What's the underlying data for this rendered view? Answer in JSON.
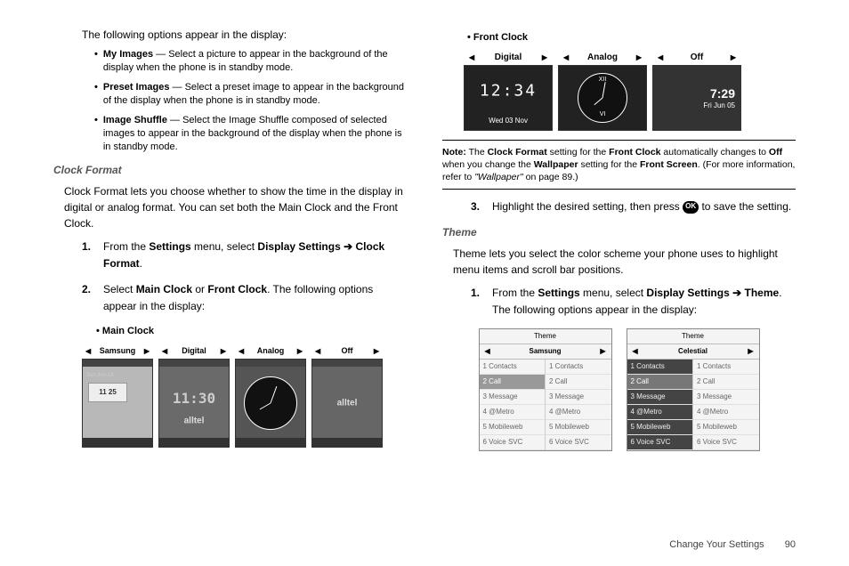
{
  "left": {
    "intro": "The following options appear in the display:",
    "bullets": [
      {
        "name": "My Images",
        "desc": " — Select a picture to appear in the background of the display when the phone is in standby mode."
      },
      {
        "name": "Preset Images",
        "desc": " — Select a preset image to appear in the background of the display when the phone is in standby mode."
      },
      {
        "name": "Image Shuffle",
        "desc": " — Select the Image Shuffle composed of selected images to appear in the background of the display when the phone is in standby mode."
      }
    ],
    "section_title": "Clock Format",
    "section_body": "Clock Format lets you choose whether to show the time in the display in digital or analog format. You can set both the Main Clock and the Front Clock.",
    "step1a": "From the ",
    "step1b": "Settings",
    "step1c": " menu, select ",
    "step1d": "Display Settings",
    "step1e": "Clock Format",
    "step1f": ".",
    "step2a": "Select ",
    "step2b": "Main Clock",
    "step2c": " or ",
    "step2d": "Front Clock",
    "step2e": ". The following options appear in the display:",
    "main_clock_label": "• Main Clock",
    "main_headers": [
      "Samsung",
      "Digital",
      "Analog",
      "Off"
    ],
    "main_samsung_time": "11 25",
    "main_samsung_date": "Sun Jun 14",
    "main_digital_time": "11:30",
    "main_alltel": "alltel"
  },
  "right": {
    "front_clock_label": "• Front Clock",
    "front_headers": [
      "Digital",
      "Analog",
      "Off"
    ],
    "front_digital_time": "12:34",
    "front_digital_date": "Wed 03 Nov",
    "front_off_time": "7:29",
    "front_off_date": "Fri Jun 05",
    "note_label": "Note:",
    "note_a": " The ",
    "note_b": "Clock Format",
    "note_c": " setting for the ",
    "note_d": "Front Clock",
    "note_e": " automatically changes to ",
    "note_f": "Off",
    "note_g": " when you change the ",
    "note_h": "Wallpaper",
    "note_i": " setting for the ",
    "note_j": "Front Screen",
    "note_k": ". (For more information, refer to ",
    "note_l": "\"Wallpaper\"",
    "note_m": " on page 89.)",
    "step3a": "Highlight the desired setting, then press ",
    "step3b": " to save the setting.",
    "ok_label": "OK",
    "theme_title": "Theme",
    "theme_body": "Theme lets you select the color scheme your phone uses to highlight menu items and scroll bar positions.",
    "theme_step_a": "From the ",
    "theme_step_b": "Settings",
    "theme_step_c": " menu, select ",
    "theme_step_d": "Display Settings",
    "theme_step_e": "Theme",
    "theme_step_f": ". The following options appear in the display:",
    "theme_header": "Theme",
    "theme_names": [
      "Samsung",
      "Celestial"
    ],
    "theme_items": [
      "1 Contacts",
      "2 Call",
      "3 Message",
      "4 @Metro",
      "5 Mobileweb",
      "6 Voice SVC"
    ]
  },
  "footer": {
    "text": "Change Your Settings",
    "page": "90"
  }
}
